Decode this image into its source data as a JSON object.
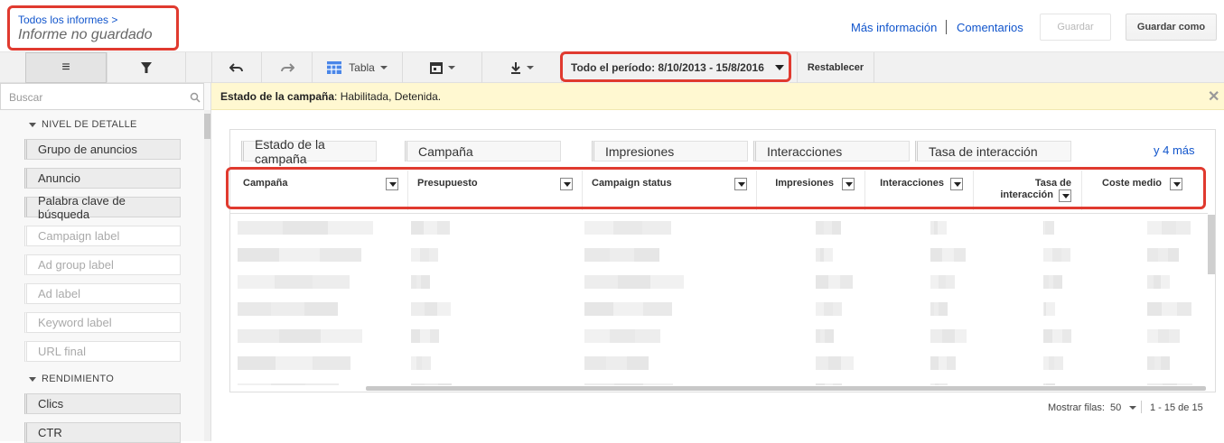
{
  "header": {
    "breadcrumb": "Todos los informes >",
    "report_title": "Informe no guardado",
    "more_info": "Más información",
    "comments": "Comentarios",
    "save_label": "Guardar",
    "save_as_label": "Guardar como"
  },
  "toolbar": {
    "table_label": "Tabla",
    "date_range": "Todo el período: 8/10/2013 - 15/8/2016",
    "reset_label": "Restablecer"
  },
  "sidebar": {
    "search_placeholder": "Buscar",
    "detail_title": "NIVEL DE DETALLE",
    "detail_items": [
      {
        "label": "Grupo de anuncios"
      },
      {
        "label": "Anuncio"
      },
      {
        "label": "Palabra clave de búsqueda"
      },
      {
        "label": "Campaign label"
      },
      {
        "label": "Ad group label"
      },
      {
        "label": "Ad label"
      },
      {
        "label": "Keyword label"
      },
      {
        "label": "URL final"
      }
    ],
    "performance_title": "RENDIMIENTO",
    "performance_items": [
      {
        "label": "Clics"
      },
      {
        "label": "CTR"
      }
    ]
  },
  "notice": {
    "label": "Estado de la campaña",
    "value": ": Habilitada, Detenida."
  },
  "table": {
    "column_chips": [
      "Estado de la campaña",
      "Campaña",
      "Impresiones",
      "Interacciones",
      "Tasa de interacción"
    ],
    "more_link": "y 4 más",
    "headers": [
      "Campaña",
      "Presupuesto",
      "Campaign status",
      "Impresiones",
      "Interacciones",
      "Tasa de",
      "interacción",
      "Coste medio"
    ]
  },
  "pagination": {
    "rows_label": "Mostrar filas:",
    "rows_value": "50",
    "range": "1 - 15 de 15"
  },
  "colors": {
    "link": "#1155cc",
    "highlight": "#e03a2f",
    "notice_bg": "#fff8d1"
  }
}
